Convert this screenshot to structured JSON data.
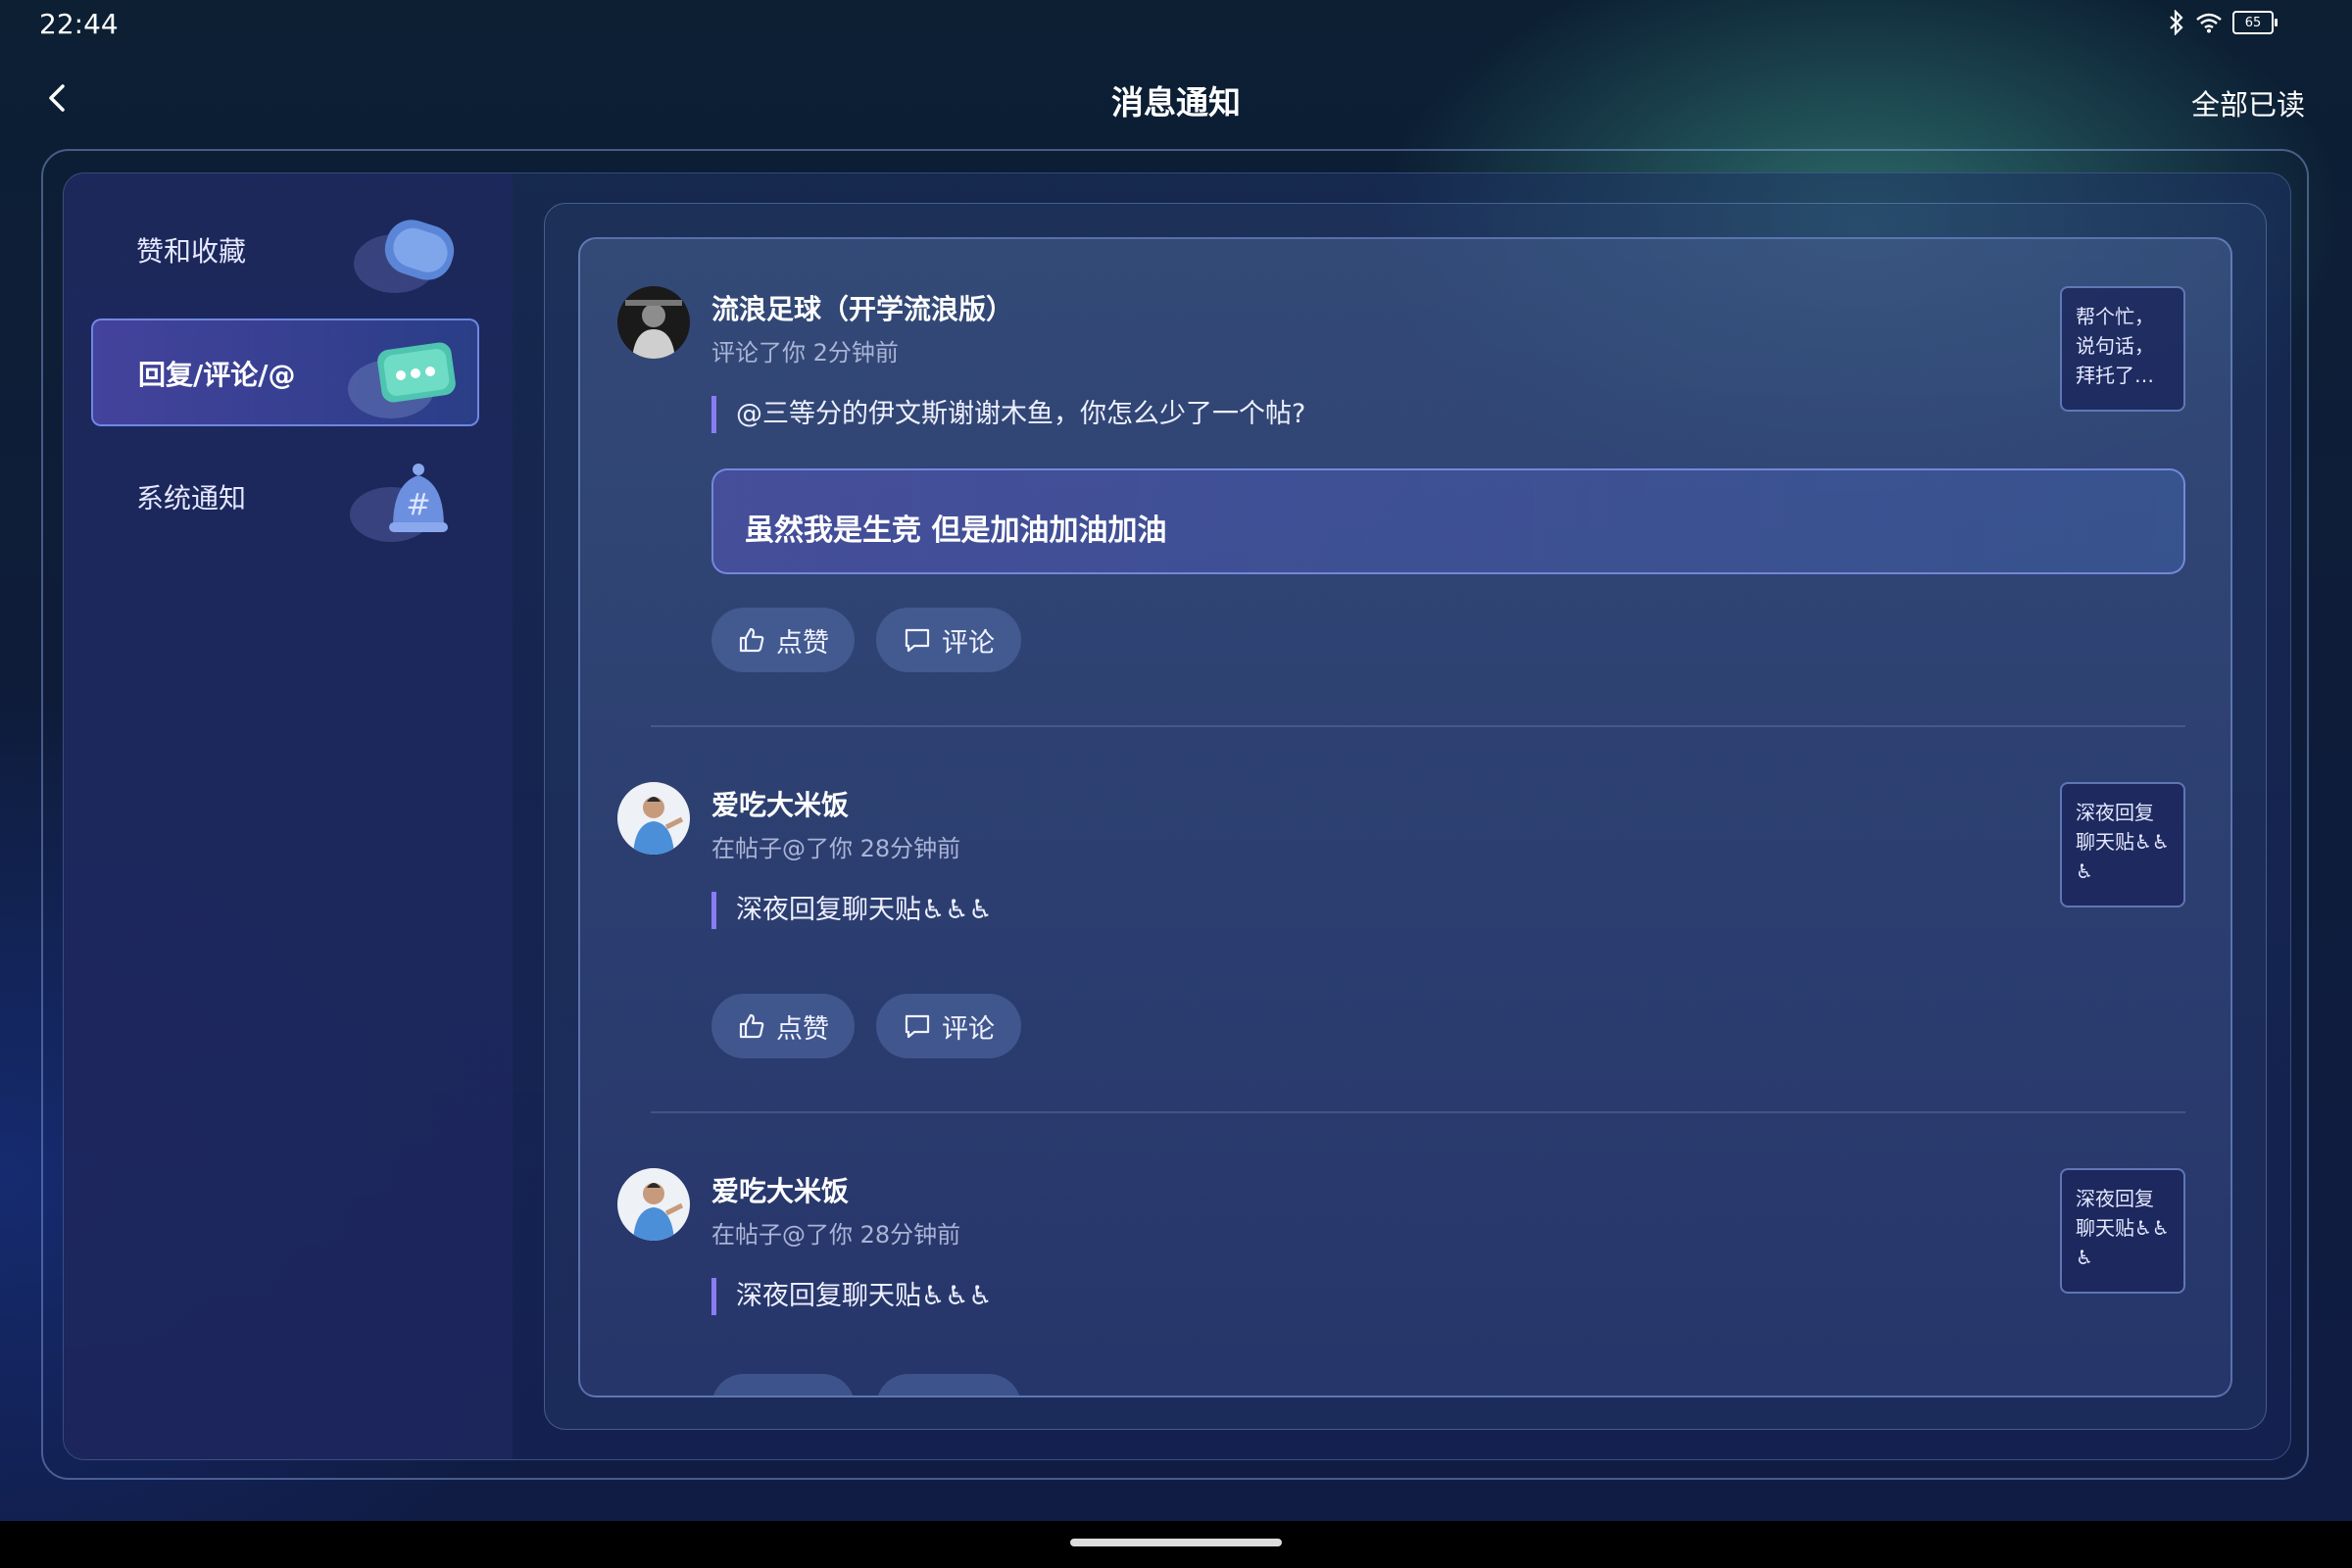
{
  "status": {
    "time": "22:44",
    "battery": "65"
  },
  "header": {
    "title": "消息通知",
    "mark_all_read": "全部已读"
  },
  "sidebar": {
    "items": [
      {
        "label": "赞和收藏",
        "icon": "heart-chat-icon",
        "active": false
      },
      {
        "label": "回复/评论/@",
        "icon": "chat-bubble-icon",
        "active": true
      },
      {
        "label": "系统通知",
        "icon": "bell-hash-icon",
        "active": false
      }
    ]
  },
  "notifications": [
    {
      "user": "流浪足球（开学流浪版）",
      "meta": "评论了你 2分钟前",
      "quote": "@三等分的伊文斯谢谢木鱼，你怎么少了一个帖?",
      "reply": "虽然我是生竞 但是加油加油加油",
      "thumb_text": "帮个忙，说句话，拜托了…",
      "like_label": "点赞",
      "comment_label": "评论"
    },
    {
      "user": "爱吃大米饭",
      "meta": "在帖子@了你 28分钟前",
      "quote": "深夜回复聊天贴♿♿♿",
      "thumb_text": "深夜回复聊天贴♿♿♿",
      "like_label": "点赞",
      "comment_label": "评论"
    },
    {
      "user": "爱吃大米饭",
      "meta": "在帖子@了你 28分钟前",
      "quote": "深夜回复聊天贴♿♿♿",
      "thumb_text": "深夜回复聊天贴♿♿♿"
    }
  ],
  "colors": {
    "accent": "#8a7cf5",
    "active_border": "#82a0ff",
    "bg_top": "#0c1f33",
    "bg_bottom": "#101c44"
  }
}
